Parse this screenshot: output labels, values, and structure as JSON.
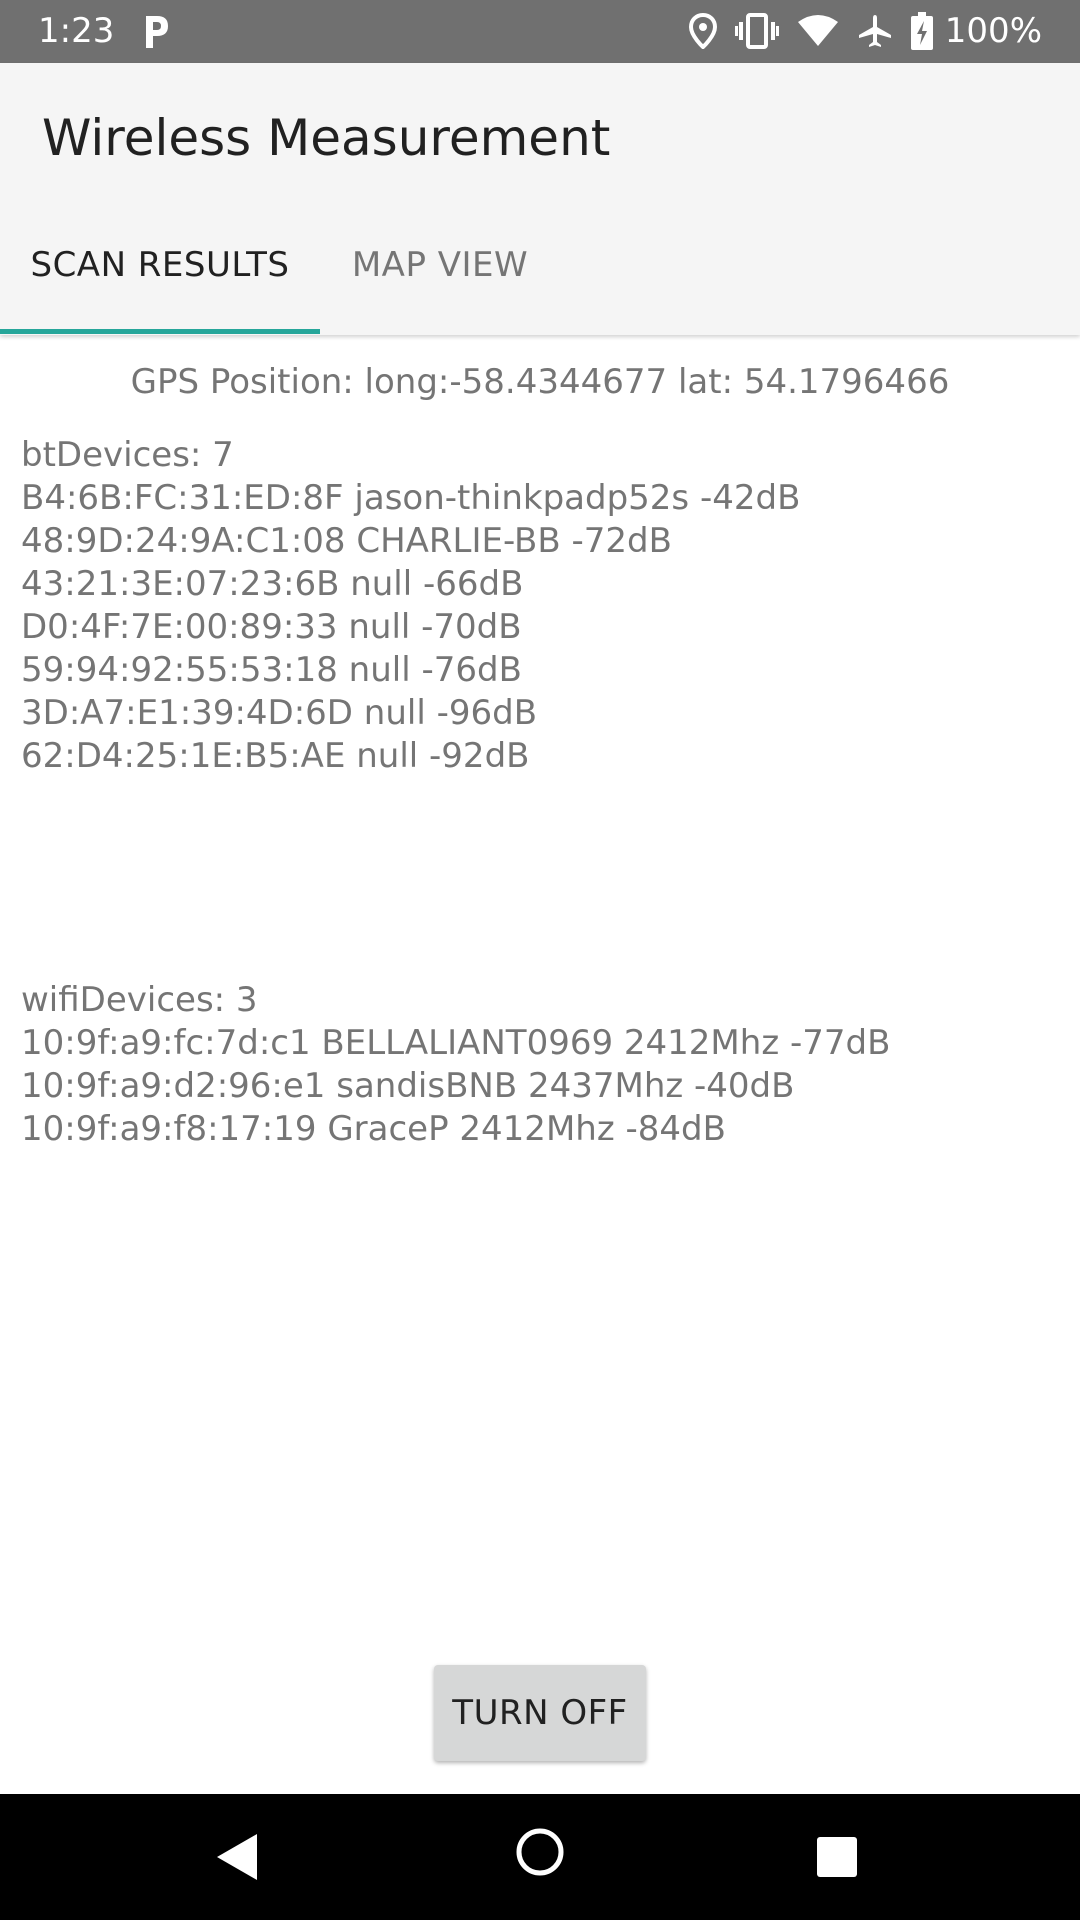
{
  "status_bar": {
    "time": "1:23",
    "battery_text": "100%",
    "icons": [
      "parking-icon",
      "location-icon",
      "vibrate-icon",
      "wifi-icon",
      "airplane-icon",
      "battery-charging-icon"
    ]
  },
  "app_bar": {
    "title": "Wireless Measurement",
    "tabs": [
      {
        "label": "SCAN RESULTS",
        "selected": true
      },
      {
        "label": "MAP VIEW",
        "selected": false
      }
    ],
    "accent_color": "#26A69A"
  },
  "gps": {
    "text": "GPS Position: long:-58.4344677 lat: 54.1796466"
  },
  "bt": {
    "header": "btDevices: 7",
    "devices": [
      "B4:6B:FC:31:ED:8F jason-thinkpadp52s -42dB",
      "48:9D:24:9A:C1:08 CHARLIE-BB -72dB",
      "43:21:3E:07:23:6B null -66dB",
      "D0:4F:7E:00:89:33 null -70dB",
      "59:94:92:55:53:18 null -76dB",
      "3D:A7:E1:39:4D:6D null -96dB",
      "62:D4:25:1E:B5:AE null -92dB"
    ]
  },
  "wifi": {
    "header": "wifiDevices: 3",
    "devices": [
      "10:9f:a9:fc:7d:c1 BELLALIANT0969 2412Mhz -77dB",
      "10:9f:a9:d2:96:e1 sandisBNB 2437Mhz -40dB",
      "10:9f:a9:f8:17:19 GraceP 2412Mhz -84dB"
    ]
  },
  "button": {
    "label": "TURN OFF"
  },
  "nav_bar": {
    "icons": [
      "back-icon",
      "home-icon",
      "recents-icon"
    ]
  }
}
